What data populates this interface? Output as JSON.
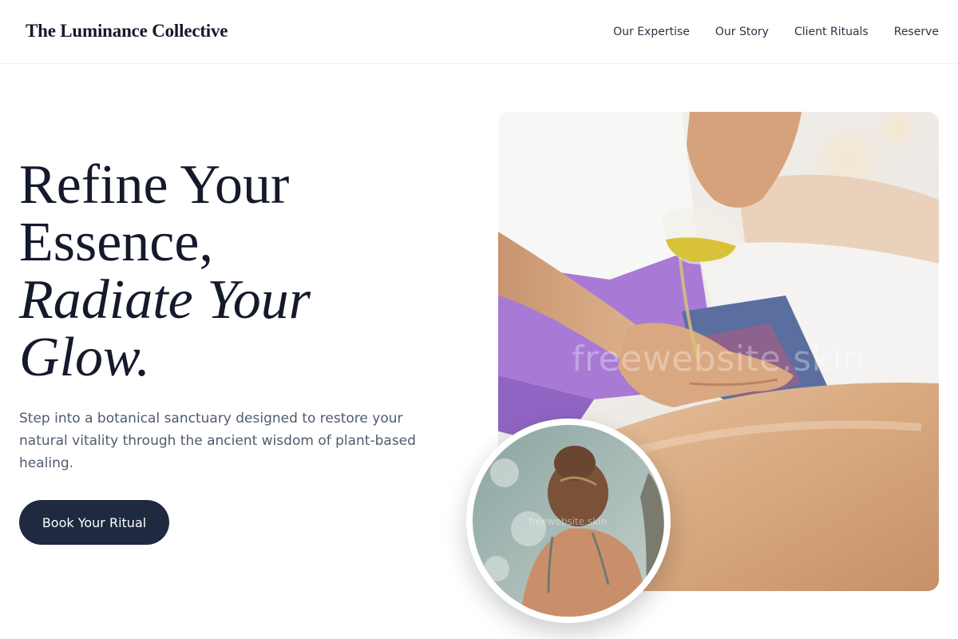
{
  "brand": {
    "name": "The Luminance Collective"
  },
  "nav": {
    "items": [
      {
        "label": "Our Expertise"
      },
      {
        "label": "Our Story"
      },
      {
        "label": "Client Rituals"
      },
      {
        "label": "Reserve"
      }
    ]
  },
  "hero": {
    "headline_line1": "Refine Your",
    "headline_line2": "Essence,",
    "headline_line3": "Radiate Your",
    "headline_line4": "Glow.",
    "lede": "Step into a botanical sanctuary designed to restore your natural vitality through the ancient wisdom of plant-based healing.",
    "cta_label": "Book Your Ritual"
  },
  "images": {
    "main_watermark": "freewebsite.skin",
    "inset_watermark": "freewebsite.skin"
  },
  "colors": {
    "navy": "#1f2a40",
    "ink": "#141a2b",
    "muted": "#4f5b6d",
    "lavender": "#a87ad6",
    "skin": "#d9ae86"
  }
}
